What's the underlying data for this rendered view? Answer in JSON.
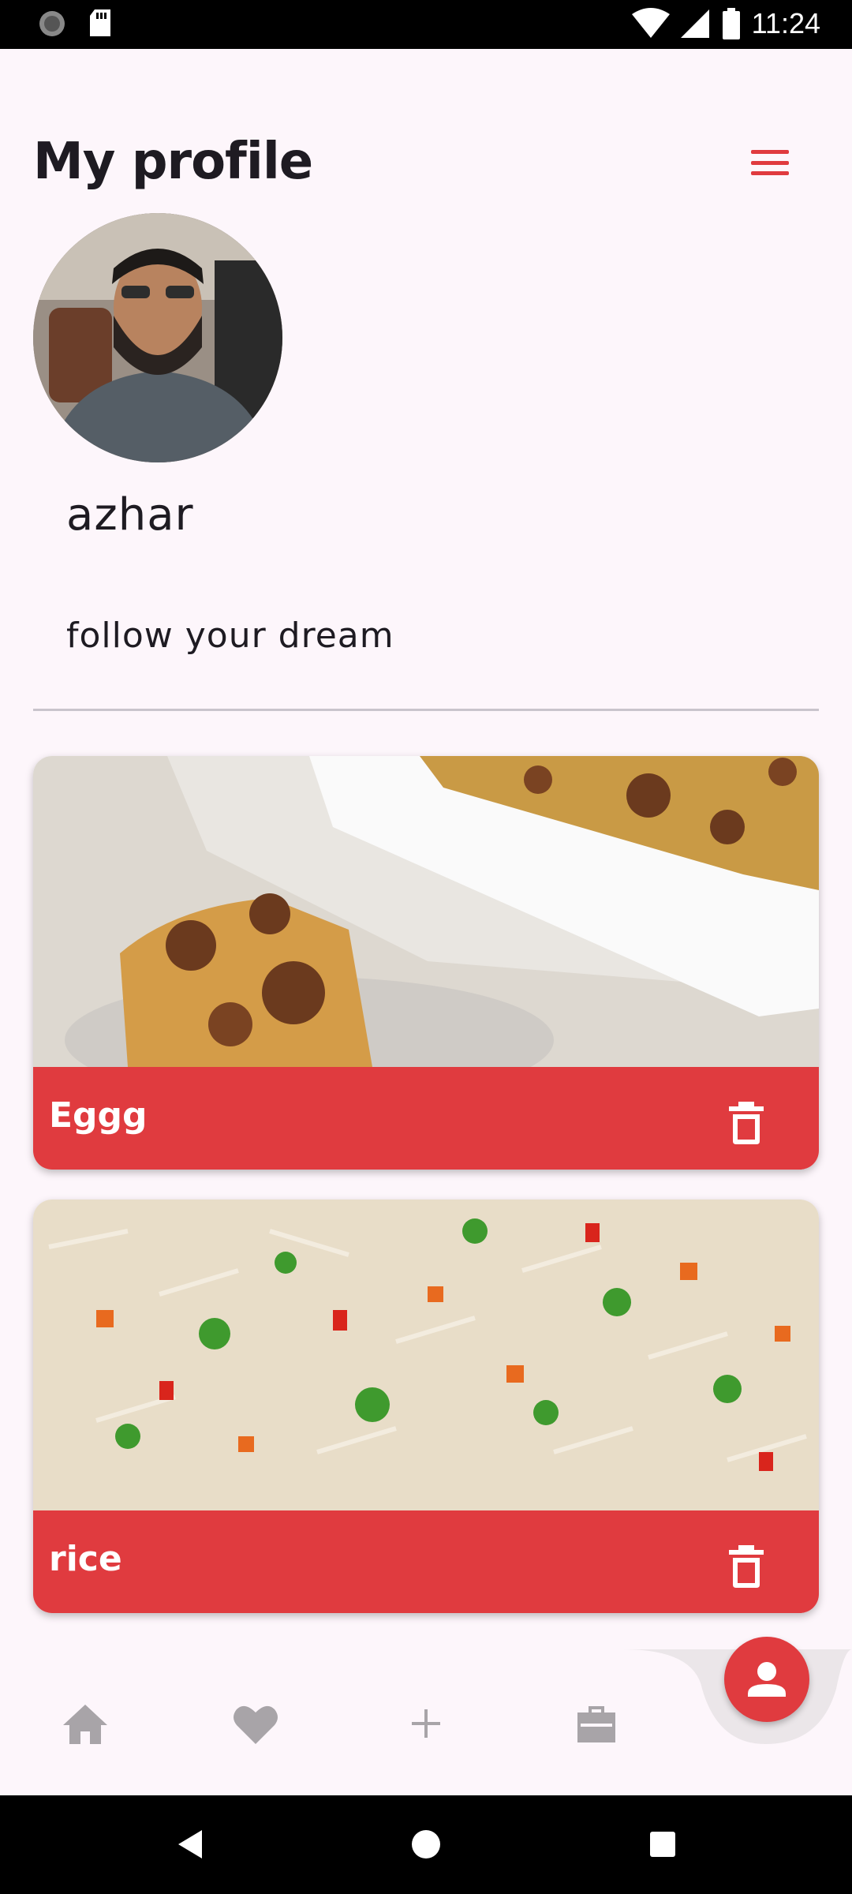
{
  "status_bar": {
    "time": "11:24"
  },
  "header": {
    "title": "My profile",
    "menu_icon": "hamburger-menu-icon"
  },
  "profile": {
    "username": "azhar",
    "bio": "follow your dream"
  },
  "recipes": [
    {
      "title": "Eggg",
      "action_icon": "trash-icon"
    },
    {
      "title": "rice",
      "action_icon": "trash-icon"
    }
  ],
  "bottom_nav": {
    "items": [
      "home-icon",
      "heart-icon",
      "plus-icon",
      "briefcase-icon",
      "person-icon"
    ],
    "active": "person-icon"
  },
  "colors": {
    "accent": "#e03b3f",
    "background": "#fdf6fb",
    "text": "#1e1b22"
  }
}
